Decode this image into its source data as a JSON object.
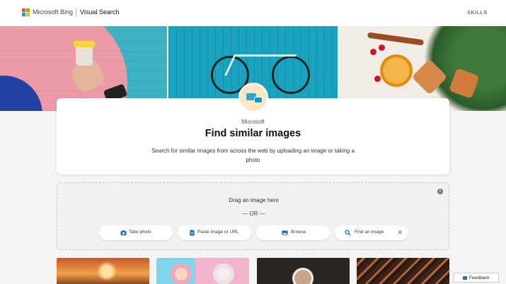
{
  "header": {
    "brand": "Microsoft Bing",
    "product": "Visual Search",
    "skills_label": "SKILLS"
  },
  "intro": {
    "brand_label": "Microsoft",
    "title": "Find similar images",
    "subtitle": "Search for similar images from across the web by uploading an image or taking a photo"
  },
  "upload": {
    "info_icon": "i",
    "drag_text": "Drag an image here",
    "or_text": "— OR —",
    "buttons": {
      "take_photo": "Take photo",
      "paste": "Paste image or URL",
      "browse": "Browse",
      "find": "Find an image"
    },
    "close_glyph": "✕"
  },
  "feedback": {
    "label": "Feedback"
  },
  "colors": {
    "bing_red": "#f25022",
    "bing_green": "#7fba00",
    "bing_blue": "#00a4ef",
    "bing_yellow": "#ffb900",
    "icon_accent": "#1f6fb5"
  },
  "icons": {
    "take_photo": "camera-icon",
    "paste": "document-icon",
    "browse": "image-icon",
    "find": "search-icon"
  }
}
